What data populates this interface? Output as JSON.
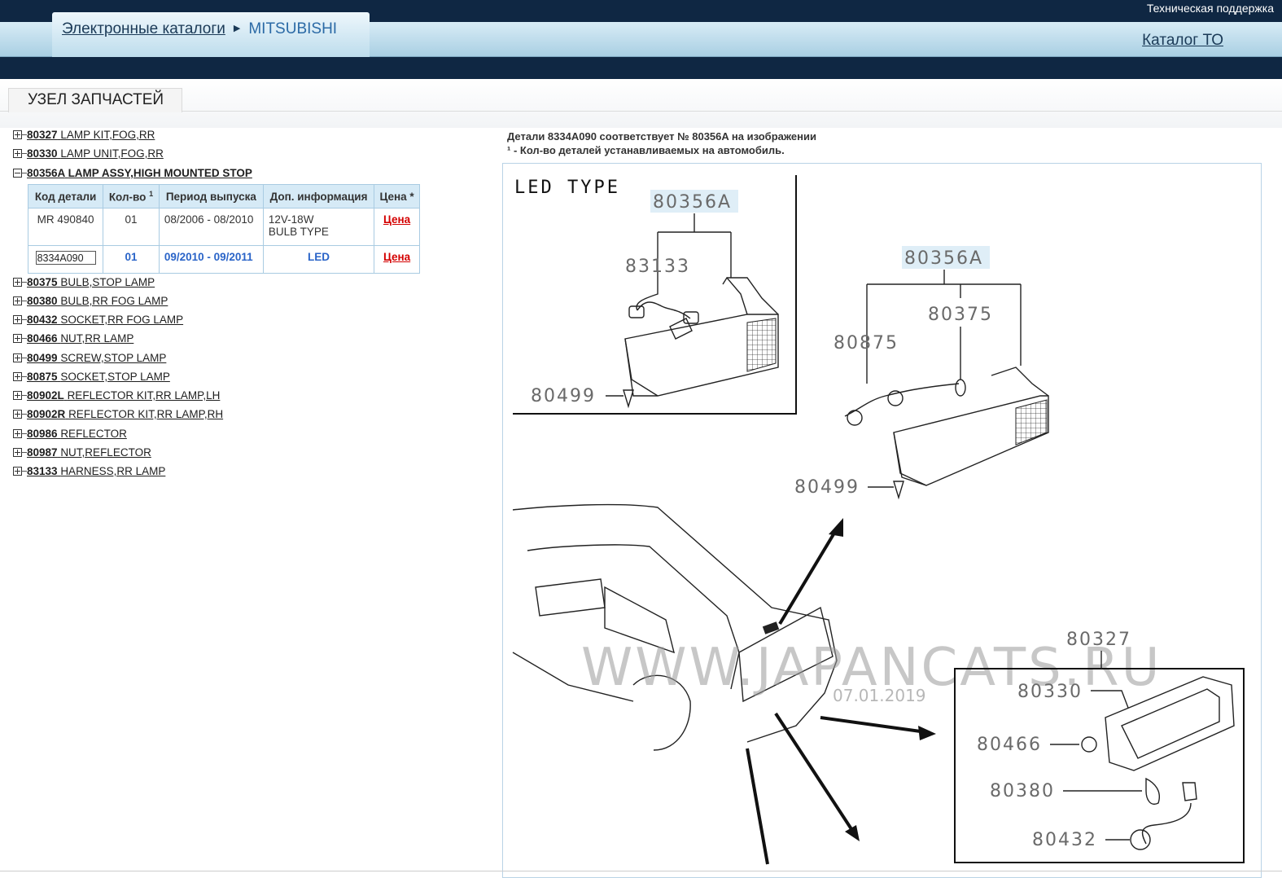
{
  "header": {
    "support_link": "Техническая поддержка",
    "breadcrumb": [
      "Электронные каталоги",
      "MITSUBISHI"
    ],
    "catalog_link": "Каталог ТО"
  },
  "section": {
    "title": "УЗЕЛ ЗАПЧАСТЕЙ"
  },
  "tree": [
    {
      "code": "80327",
      "name": "LAMP KIT,FOG,RR",
      "expanded": false
    },
    {
      "code": "80330",
      "name": "LAMP UNIT,FOG,RR",
      "expanded": false
    },
    {
      "code": "80356A",
      "name": "LAMP ASSY,HIGH MOUNTED STOP",
      "expanded": true
    },
    {
      "code": "80375",
      "name": "BULB,STOP LAMP",
      "expanded": false
    },
    {
      "code": "80380",
      "name": "BULB,RR FOG LAMP",
      "expanded": false
    },
    {
      "code": "80432",
      "name": "SOCKET,RR FOG LAMP",
      "expanded": false
    },
    {
      "code": "80466",
      "name": "NUT,RR LAMP",
      "expanded": false
    },
    {
      "code": "80499",
      "name": "SCREW,STOP LAMP",
      "expanded": false
    },
    {
      "code": "80875",
      "name": "SOCKET,STOP LAMP",
      "expanded": false
    },
    {
      "code": "80902L",
      "name": "REFLECTOR KIT,RR LAMP,LH",
      "expanded": false
    },
    {
      "code": "80902R",
      "name": "REFLECTOR KIT,RR LAMP,RH",
      "expanded": false
    },
    {
      "code": "80986",
      "name": "REFLECTOR",
      "expanded": false
    },
    {
      "code": "80987",
      "name": "NUT,REFLECTOR",
      "expanded": false
    },
    {
      "code": "83133",
      "name": "HARNESS,RR LAMP",
      "expanded": false
    }
  ],
  "table": {
    "headers": [
      "Код детали",
      "Кол-во",
      "Период выпуска",
      "Доп. информация",
      "Цена *"
    ],
    "qty_sup": "1",
    "rows": [
      {
        "code": "MR 490840",
        "qty": "01",
        "period": "08/2006 - 08/2010",
        "info": [
          "12V-18W",
          "BULB TYPE"
        ],
        "price": "Цена",
        "selected": false
      },
      {
        "code": "8334A090",
        "qty": "01",
        "period": "09/2010 - 09/2011",
        "info": [
          "LED"
        ],
        "price": "Цена",
        "selected": true
      }
    ]
  },
  "info": {
    "line1": "Детали 8334A090 соответствует № 80356A на изображении",
    "line2": "¹ - Кол-во деталей устанавливаемых на автомобиль."
  },
  "diagram": {
    "led_type": "LED TYPE",
    "watermark": "WWW.JAPANCATS.RU",
    "date": "07.01.2019",
    "callouts": {
      "c80356a_1": "80356A",
      "c83133": "83133",
      "c80499_1": "80499",
      "c80356a_2": "80356A",
      "c80375": "80375",
      "c80875": "80875",
      "c80499_2": "80499",
      "c80327": "80327",
      "c80330": "80330",
      "c80466": "80466",
      "c80380": "80380",
      "c80432": "80432"
    }
  },
  "colors": {
    "navy": "#0f2743",
    "header_blue": "#a9cfe3",
    "table_header": "#d6eaf6",
    "selected_text": "#2a64c8",
    "price_red": "#d40000"
  }
}
